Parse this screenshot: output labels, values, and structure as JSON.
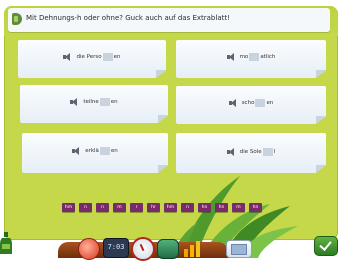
{
  "instruction": "Mit Dehnungs-h oder ohne? Guck auch auf das Extrablatt!",
  "cards": [
    {
      "before": "die Perso",
      "after": "en"
    },
    {
      "before": "mo",
      "after": "atlich"
    },
    {
      "before": "teilne",
      "after": "en"
    },
    {
      "before": "scho",
      "after": "en"
    },
    {
      "before": "erklä",
      "after": "en"
    },
    {
      "before": "die Sole",
      "after": "l"
    }
  ],
  "tiles": [
    "hm",
    "n",
    "n",
    "m",
    "r",
    "hr",
    "hm",
    "n",
    "hn",
    "hn",
    "m",
    "hn"
  ],
  "toolbar": {
    "clock_text": "7:03"
  },
  "colors": {
    "board": "#c4d84a",
    "tile": "#7a2a6a",
    "banner": "#f5f8fb",
    "check": "#3b9a2c"
  },
  "icons": [
    "pin-icon",
    "speaker-icon",
    "bottle-icon",
    "red-gem-icon",
    "clock-icon",
    "gauge-icon",
    "globe-icon",
    "bars-icon",
    "folders-icon",
    "check-icon"
  ]
}
